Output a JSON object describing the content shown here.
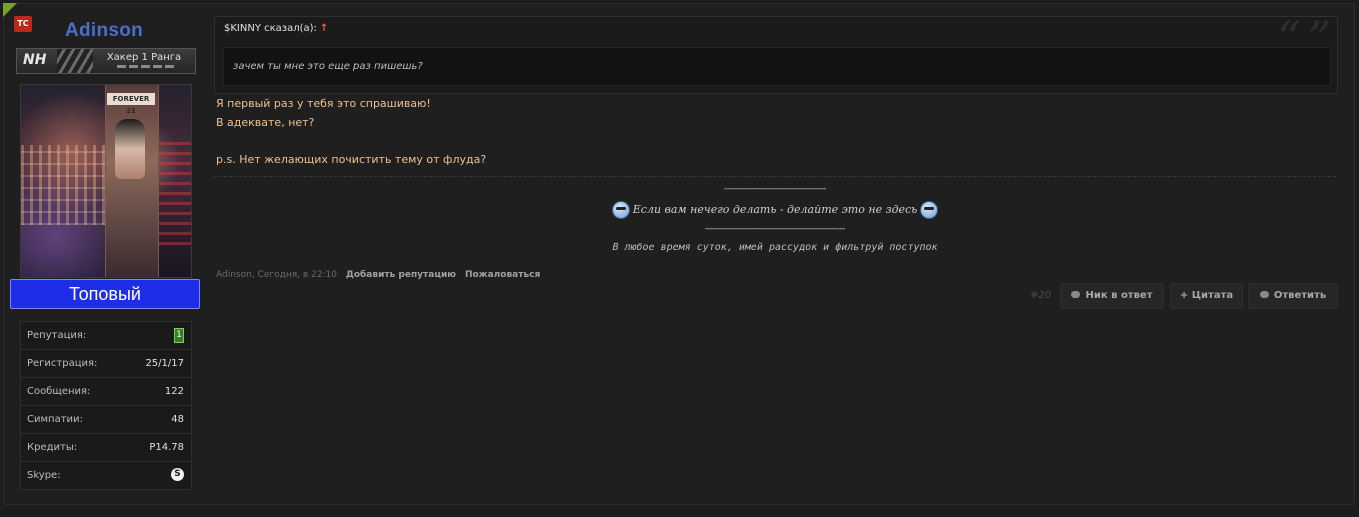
{
  "user": {
    "badge": "TC",
    "name": "Adinson",
    "rank_logo": "NH",
    "rank_title": "Хакер 1 Ранга",
    "status": "Топовый",
    "avatar_sign": "FOREVER 21",
    "stats": [
      {
        "label": "Репутация:",
        "value": "1"
      },
      {
        "label": "Регистрация:",
        "value": "25/1/17"
      },
      {
        "label": "Сообщения:",
        "value": "122"
      },
      {
        "label": "Симпатии:",
        "value": "48"
      },
      {
        "label": "Кредиты:",
        "value": "P14.78"
      },
      {
        "label": "Skype:",
        "value": "S"
      }
    ]
  },
  "quote": {
    "author": "$KINNY сказал(а):",
    "arrow": "↑",
    "marks": "“ ”",
    "text": "зачем ты мне это еще раз пишешь?"
  },
  "message": {
    "lines": [
      "Я первый раз у тебя это спрашиваю!",
      "В адеквате, нет?",
      "",
      "p.s. Нет желающих почистить тему от флуда?"
    ]
  },
  "signature": {
    "dash_top": "-------------------------------------",
    "main": "Если вам нечего делать - делайте это не здесь",
    "dash_bottom": "---------------------------------------------------",
    "motto": "В любое время суток, имей рассудок и фильтруй поступок"
  },
  "meta": {
    "author_time": "Adinson, Сегодня, в 22:10",
    "add_rep": "Добавить репутацию",
    "report": "Пожаловаться"
  },
  "actions": {
    "post_number": "#20",
    "nick_reply": "Ник в ответ",
    "quote": "+ Цитата",
    "reply": "Ответить"
  },
  "colors": {
    "status_bg": "#1e2ee8",
    "username": "#4b6ec8",
    "message_text": "#f0c090",
    "corner": "#76a32a"
  }
}
